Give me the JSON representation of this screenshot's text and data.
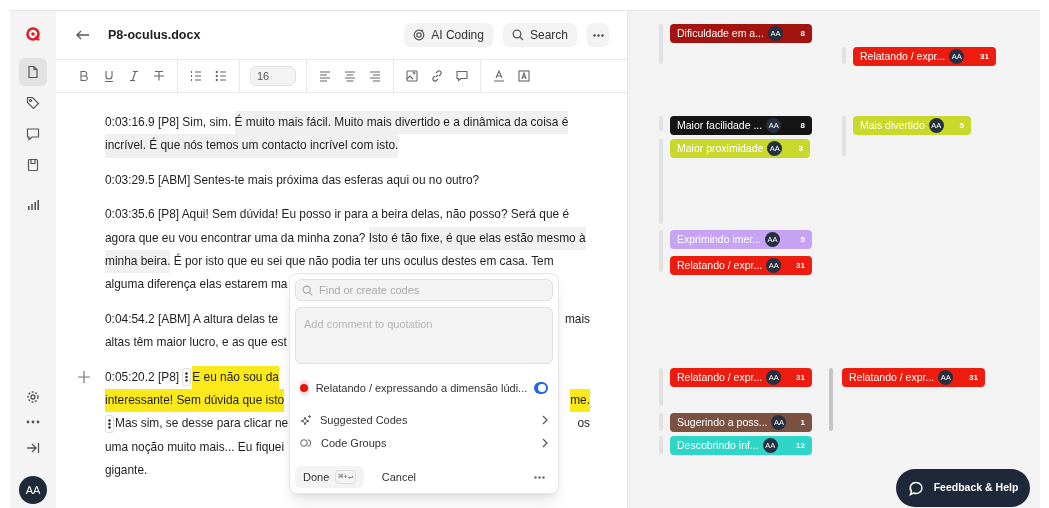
{
  "sidebar": {
    "nav_items": [
      {
        "selected": true
      },
      {
        "selected": false
      },
      {
        "selected": false
      },
      {
        "selected": false
      },
      {
        "selected": false
      }
    ],
    "user_avatar": "AA"
  },
  "document": {
    "title": "P8-oculus.docx",
    "actions": [
      "AI Coding",
      "Search"
    ],
    "font_size": "16"
  },
  "paragraphs": [
    {
      "gutter_plus": false,
      "lines": [
        {
          "left": [
            {
              "text": "0:03:16.9 [P8] Sim, sim. ",
              "coded": false,
              "selected": false
            },
            {
              "text": "É muito mais fácil. Muito mais divertido e a dinâmica da coisa é",
              "coded": true,
              "selected": false
            }
          ]
        },
        {
          "left": [
            {
              "text": "incrível. É que nós temos um contacto incrível com isto.",
              "coded": true,
              "selected": false
            }
          ]
        }
      ]
    },
    {
      "gutter_plus": false,
      "lines": [
        {
          "left": [
            {
              "text": "0:03:29.5 [ABM] Sentes-te mais próxima das esferas aqui ou no outro?",
              "coded": false,
              "selected": false
            }
          ]
        }
      ]
    },
    {
      "gutter_plus": false,
      "lines": [
        {
          "left": [
            {
              "text": "0:03:35.6 [P8] Aqui! Sem dúvida! Eu posso ir para a beira delas, não posso? Será que é",
              "coded": false,
              "selected": false
            }
          ]
        },
        {
          "left": [
            {
              "text": "agora que eu vou encontrar uma da minha zona? ",
              "coded": false,
              "selected": false
            },
            {
              "text": "Isto é tão fixe, é que elas estão mesmo à",
              "coded": true,
              "selected": false
            }
          ]
        },
        {
          "left": [
            {
              "text": "minha beira.",
              "coded": true,
              "selected": false
            },
            {
              "text": " É por isto que eu sei que não podia ter uns oculus destes em casa. Tem",
              "coded": false,
              "selected": false
            }
          ]
        },
        {
          "left": [
            {
              "text": "alguma diferença elas estarem ma",
              "coded": false,
              "selected": false
            }
          ]
        }
      ]
    },
    {
      "gutter_plus": false,
      "lines": [
        {
          "left": [
            {
              "text": "0:04:54.2 [ABM] A altura delas te",
              "coded": false,
              "selected": false
            }
          ],
          "right": [
            {
              "text": "mais",
              "coded": false,
              "selected": false
            }
          ]
        },
        {
          "left": [
            {
              "text": "altas têm maior lucro, e as que est",
              "coded": false,
              "selected": false
            }
          ]
        }
      ]
    },
    {
      "gutter_plus": true,
      "lines": [
        {
          "left": [
            {
              "text": "0:05:20.2 [P8] ",
              "coded": false,
              "selected": false
            },
            {
              "kind": "handle"
            },
            {
              "text": "E eu não sou da",
              "coded": false,
              "selected": true
            }
          ]
        },
        {
          "left": [
            {
              "text": "interessante! Sem dúvida que isto",
              "coded": false,
              "selected": true
            }
          ],
          "right": [
            {
              "text": "me.",
              "coded": false,
              "selected": true
            }
          ]
        },
        {
          "left": [
            {
              "kind": "handle"
            },
            {
              "text": "Mas sim, se desse para clicar ne",
              "coded": false,
              "selected": false
            }
          ],
          "right": [
            {
              "text": "os",
              "coded": false,
              "selected": false
            }
          ]
        },
        {
          "left": [
            {
              "text": "uma noção muito mais... Eu fiquei",
              "coded": false,
              "selected": false
            }
          ]
        },
        {
          "left": [
            {
              "text": "gigante.",
              "coded": false,
              "selected": false
            }
          ]
        }
      ]
    }
  ],
  "popup": {
    "search_placeholder": "Find or create codes",
    "comment_placeholder": "Add comment to quotation",
    "code": {
      "label": "Relatando / expressando a dimensão lúdi...",
      "color": "#e8140c",
      "on": true
    },
    "menu": [
      "Suggested Codes",
      "Code Groups"
    ],
    "done": "Done",
    "shortcut": "⌘+↵",
    "cancel": "Cancel"
  },
  "margin_codes": [
    {
      "label": "Dificuldade em a...",
      "color": "#a3130f",
      "avatar": "AA",
      "count": "8"
    },
    {
      "label": "Relatando / expr...",
      "color": "#ee1c0f",
      "avatar": "AA",
      "count": "31"
    },
    {
      "label": "Maior facilidade ...",
      "color": "#151515",
      "avatar": "AA",
      "count": "8"
    },
    {
      "label": "Mais divertido",
      "color": "#c8d92c",
      "avatar": "AA",
      "count": "5"
    },
    {
      "label": "Maior proximidade",
      "color": "#c8d92c",
      "avatar": "AA",
      "count": "3"
    },
    {
      "label": "Exprimindo imer...",
      "color": "#c7a3f3",
      "avatar": "AA",
      "count": "5"
    },
    {
      "label": "Relatando / expr...",
      "color": "#ee1c0f",
      "avatar": "AA",
      "count": "31"
    },
    {
      "label": "Relatando / expr...",
      "color": "#ee1c0f",
      "avatar": "AA",
      "count": "31"
    },
    {
      "label": "Relatando / expr...",
      "color": "#ee1c0f",
      "avatar": "AA",
      "count": "31"
    },
    {
      "label": "Sugerindo a poss...",
      "color": "#7b5142",
      "avatar": "AA",
      "count": "1"
    },
    {
      "label": "Descobrindo inf...",
      "color": "#2fd5c6",
      "avatar": "AA",
      "count": "12"
    }
  ],
  "feedback_button": "Feedback & Help"
}
